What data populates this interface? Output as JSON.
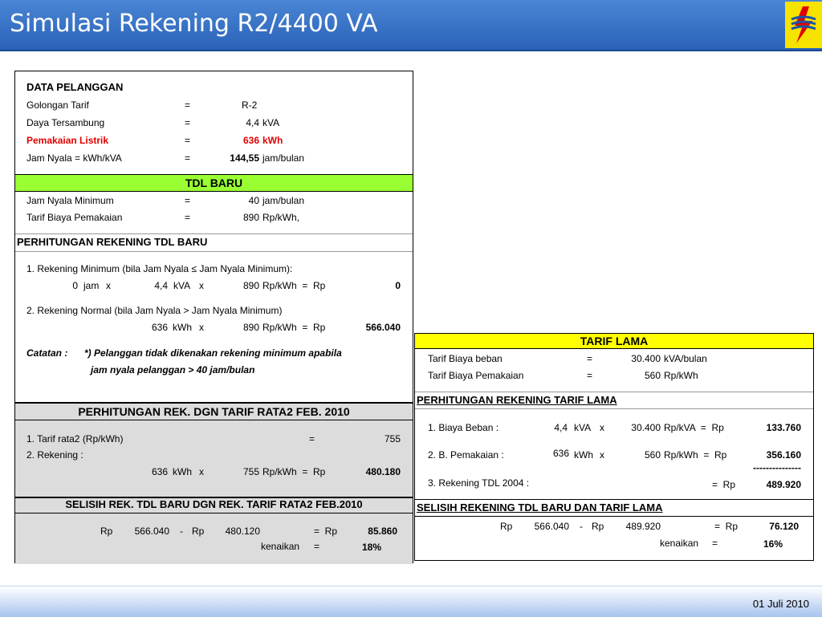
{
  "slide": {
    "title": "Simulasi Rekening R2/4400 VA",
    "date": "01 Juli 2010"
  },
  "data_pelanggan": {
    "heading": "DATA PELANGGAN",
    "rows": [
      {
        "label": "Golongan Tarif",
        "eq": "=",
        "value": "R-2",
        "unit": ""
      },
      {
        "label": "Daya Tersambung",
        "eq": "=",
        "value": "4,4",
        "unit": "kVA"
      },
      {
        "label": "Pemakaian Listrik",
        "eq": "=",
        "value": "636",
        "unit": "kWh"
      },
      {
        "label": "Jam Nyala  =  kWh/kVA",
        "eq": "=",
        "value": "144,55",
        "unit": "jam/bulan"
      }
    ]
  },
  "tdl_baru": {
    "heading": "TDL  BARU",
    "rows": [
      {
        "label": "Jam Nyala Minimum",
        "eq": "=",
        "value": "40",
        "unit": "jam/bulan"
      },
      {
        "label": "Tarif Biaya Pemakaian",
        "eq": "=",
        "value": "890",
        "unit": "Rp/kWh,"
      }
    ]
  },
  "perhitungan_baru": {
    "heading": "PERHITUNGAN REKENING TDL BARU",
    "item1": {
      "label": "1. Rekening Minimum  (bila Jam Nyala  ≤  Jam Nyala Minimum):",
      "a": "0",
      "a_unit": "jam",
      "x1": "x",
      "b": "4,4",
      "b_unit": "kVA",
      "x2": "x",
      "c": "890",
      "c_unit": "Rp/kWh  =  Rp",
      "result": "0"
    },
    "item2": {
      "label": "2. Rekening Normal (bila Jam Nyala  >  Jam Nyala Minimum)",
      "a": "636",
      "a_unit": "kWh",
      "x1": "x",
      "c": "890",
      "c_unit": "Rp/kWh  =  Rp",
      "result": "566.040"
    },
    "catatan_label": "Catatan   :",
    "catatan_line1": "*) Pelanggan tidak dikenakan rekening minimum apabila",
    "catatan_line2": "jam nyala pelanggan  >  40 jam/bulan"
  },
  "rata2": {
    "heading": "PERHITUNGAN REK. DGN TARIF RATA2 FEB. 2010",
    "line1_label": "1. Tarif rata2 (Rp/kWh)",
    "line1_eq": "=",
    "line1_value": "755",
    "line2_label": "2. Rekening  :",
    "a": "636",
    "a_unit": "kWh",
    "x1": "x",
    "c": "755",
    "c_unit": "Rp/kWh  =  Rp",
    "result": "480.180"
  },
  "selisih_baru": {
    "heading": "SELISIH REK. TDL BARU DGN REK. TARIF RATA2 FEB.2010",
    "rp1": "Rp",
    "v1": "566.040",
    "minus": "-",
    "rp2": "Rp",
    "v2": "480.120",
    "eq": "=  Rp",
    "result": "85.860",
    "kenaikan_label": "kenaikan",
    "kenaikan_eq": "=",
    "kenaikan_value": "18%"
  },
  "tarif_lama": {
    "heading": "TARIF LAMA",
    "rows": [
      {
        "label": "Tarif Biaya beban",
        "eq": "=",
        "value": "30.400",
        "unit": "kVA/bulan"
      },
      {
        "label": "Tarif Biaya Pemakaian",
        "eq": "=",
        "value": "560",
        "unit": "Rp/kWh"
      }
    ]
  },
  "perhitungan_lama": {
    "heading": "PERHITUNGAN REKENING TARIF LAMA",
    "item1": {
      "label": "1. Biaya Beban :",
      "a": "4,4",
      "a_unit": "kVA",
      "x": "x",
      "c": "30.400",
      "c_unit": "Rp/kVA  =  Rp",
      "result": "133.760"
    },
    "item2": {
      "label": "2. B. Pemakaian  :",
      "a": "636",
      "a_unit": "kWh",
      "x": "x",
      "c": "560",
      "c_unit": "Rp/kWh  =  Rp",
      "result": "356.160"
    },
    "dashes": "---------------",
    "item3": {
      "label": "3. Rekening TDL 2004  :",
      "eq": "=  Rp",
      "result": "489.920"
    }
  },
  "selisih_lama": {
    "heading": "SELISIH REKENING TDL BARU DAN TARIF LAMA",
    "rp1": "Rp",
    "v1": "566.040",
    "minus": "-",
    "rp2": "Rp",
    "v2": "489.920",
    "eq": "=  Rp",
    "result": "76.120",
    "kenaikan_label": "kenaikan",
    "kenaikan_eq": "=",
    "kenaikan_value": "16%"
  },
  "colors": {
    "header": "#2a62b8",
    "green_band": "#99ff33",
    "yellow_band": "#ffff00",
    "grey": "#dcdcdc",
    "red": "#e00000",
    "logo_bg": "#f7e300",
    "logo_mark": "#e00000"
  }
}
